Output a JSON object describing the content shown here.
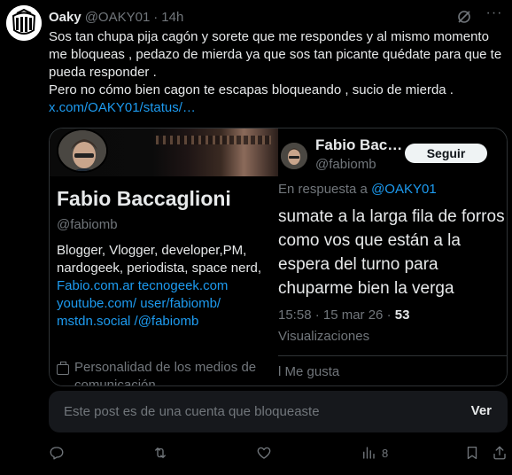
{
  "post": {
    "author_name": "Oaky",
    "author_handle": "@OAKY01",
    "separator": "·",
    "time": "14h",
    "text_line1": "Sos tan chupa pija cagón y sorete que me respondes y al mismo momento me bloqueas , pedazo de mierda ya que sos tan picante quédate para que te pueda responder .",
    "text_line2": "Pero no cómo bien cagon te escapas bloqueando , sucio de mierda .",
    "link": "x.com/OAKY01/status/…"
  },
  "profile_shot": {
    "name": "Fabio Baccaglioni",
    "handle": "@fabiomb",
    "bio_text": "Blogger, Vlogger, developer,PM, nardogeek, periodista, space nerd,",
    "bio_links": "Fabio.com.ar tecnogeek.com youtube.com/ user/fabiomb/ mstdn.social /@fabiomb",
    "category": "Personalidad de los medios de comunicación"
  },
  "reply_shot": {
    "name": "Fabio Bac…",
    "handle": "@fabiomb",
    "follow_label": "Seguir",
    "reply_prefix": "En respuesta a",
    "reply_mention": "@OAKY01",
    "text": "sumate a la larga fila de forros como vos que están a la espera del turno para chuparme bien la verga",
    "timestamp": "15:58 · 15 mar 26 ·",
    "views_count": "53",
    "views_label": "Visualizaciones",
    "likes_label": "l Me gusta"
  },
  "blocked_notice": {
    "text": "Este post es de una cuenta que bloqueaste",
    "action": "Ver"
  },
  "actions": {
    "views_count": "8"
  },
  "icons": {
    "reply": "reply-icon",
    "repost": "repost-icon",
    "like": "heart-icon",
    "views": "views-icon",
    "bookmark": "bookmark-icon",
    "share": "share-icon",
    "grok": "grok-icon",
    "more": "more-icon"
  },
  "colors": {
    "background": "#000000",
    "text": "#e7e9ea",
    "muted": "#71767b",
    "link": "#1d9bf0",
    "panel": "#16181c"
  }
}
